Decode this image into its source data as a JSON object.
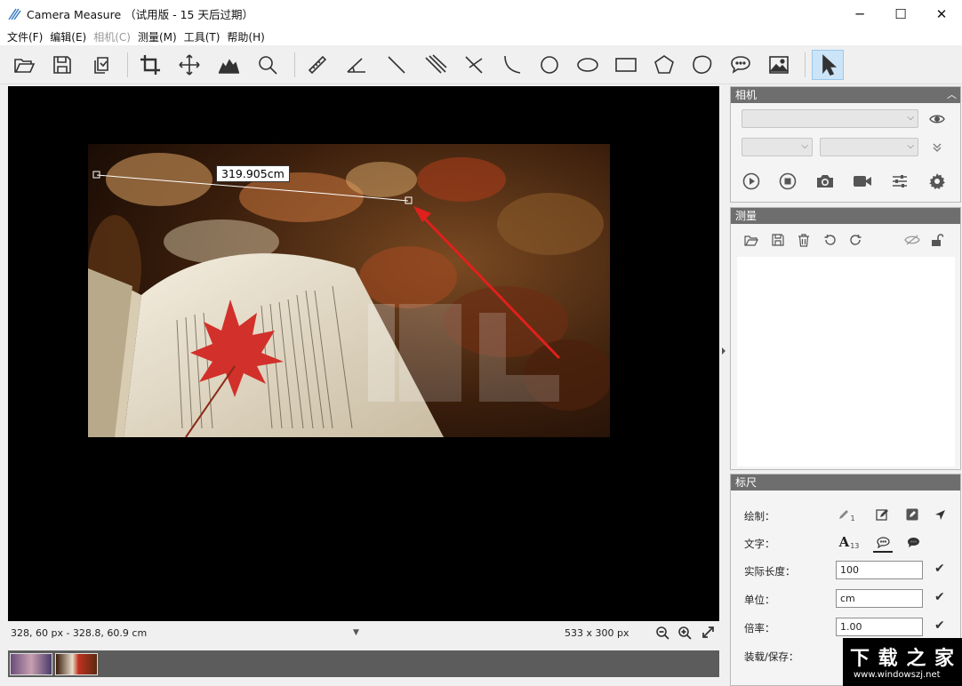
{
  "window": {
    "title": "Camera Measure （试用版 - 15 天后过期）",
    "controls": {
      "minimize": "─",
      "maximize": "☐",
      "close": "✕"
    }
  },
  "menu": [
    "文件(F)",
    "编辑(E)",
    "相机(C)",
    "测量(M)",
    "工具(T)",
    "帮助(H)"
  ],
  "menu_disabled_index": 2,
  "toolbar": {
    "icons": [
      "open-folder-icon",
      "save-icon",
      "copy-icon",
      "crop-icon",
      "move-icon",
      "histogram-icon",
      "magnifier-icon",
      "ruler-icon",
      "angle-icon",
      "line-icon",
      "parallel-lines-icon",
      "cross-lines-icon",
      "arc-icon",
      "circle-icon",
      "ellipse-icon",
      "rectangle-icon",
      "pentagon-icon",
      "closed-curve-icon",
      "comment-icon",
      "image-icon",
      "pointer-icon"
    ]
  },
  "measurement": {
    "label": "319.905cm",
    "line_color": "#ffffff",
    "arrow_color": "#e0201c"
  },
  "status": {
    "cursor": "328, 60 px - 328.8, 60.9 cm",
    "dropdown": "▼",
    "image_size": "533 x 300 px"
  },
  "camera_panel": {
    "title": "相机",
    "collapse": "︿"
  },
  "measure_panel": {
    "title": "测量"
  },
  "ruler_panel": {
    "title": "标尺",
    "draw_label": "绘制：",
    "draw_sub": "1",
    "text_label": "文字：",
    "text_sub": "13",
    "text_glyph": "A",
    "real_length_label": "实际长度：",
    "real_length_value": "100",
    "unit_label": "单位：",
    "unit_value": "cm",
    "ratio_label": "倍率：",
    "ratio_value": "1.00",
    "load_save_label": "装载/保存："
  },
  "watermark": {
    "main": "下 载 之 家",
    "url": "www.windowszj.net"
  },
  "colors": {
    "accent": "#cce4f7",
    "panel_header": "#6e6e6e",
    "viewport": "#000000"
  }
}
